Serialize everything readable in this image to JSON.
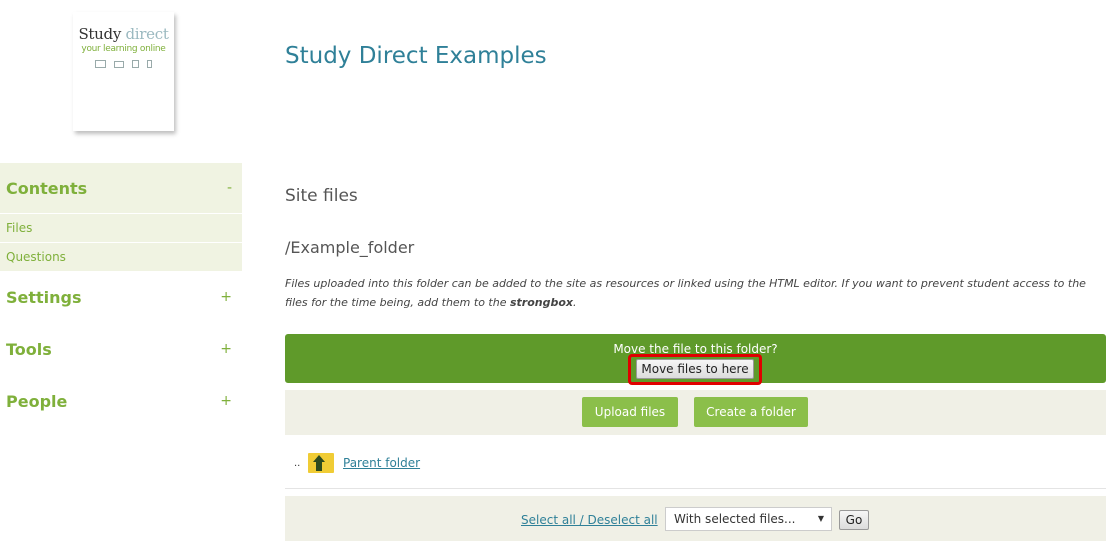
{
  "logo": {
    "brand_bold": "Study",
    "brand_light": "direct",
    "tagline": "your learning online",
    "devices": [
      "desktop-icon",
      "laptop-icon",
      "tablet-icon",
      "phone-icon"
    ]
  },
  "header": {
    "title": "Study Direct Examples"
  },
  "sidebar": {
    "blocks": [
      {
        "label": "Contents",
        "toggle": "-",
        "items": [
          "Files",
          "Questions"
        ]
      },
      {
        "label": "Settings",
        "toggle": "+"
      },
      {
        "label": "Tools",
        "toggle": "+"
      },
      {
        "label": "People",
        "toggle": "+"
      }
    ]
  },
  "main": {
    "section_title": "Site files",
    "folder_path": "/Example_folder",
    "description_before": "Files uploaded into this folder can be added to the site as resources or linked using the HTML editor. If you want to prevent student access to the files for the time being, add them to the ",
    "description_bold": "strongbox",
    "description_after": ".",
    "move_prompt": "Move the file to this folder?",
    "move_button": "Move files to here",
    "upload_button": "Upload files",
    "create_folder_button": "Create a folder",
    "parent_marker": "..",
    "parent_link": "Parent folder",
    "select_all_link": "Select all / Deselect all",
    "with_selected": {
      "selected": "With selected files...",
      "caret": "▼"
    },
    "go_button": "Go"
  },
  "colors": {
    "accent_green": "#7fb03b",
    "dark_green_bar": "#5f9a2a",
    "button_green": "#8bbf4a",
    "link_blue": "#2f8098",
    "highlight_red": "#e00000"
  }
}
